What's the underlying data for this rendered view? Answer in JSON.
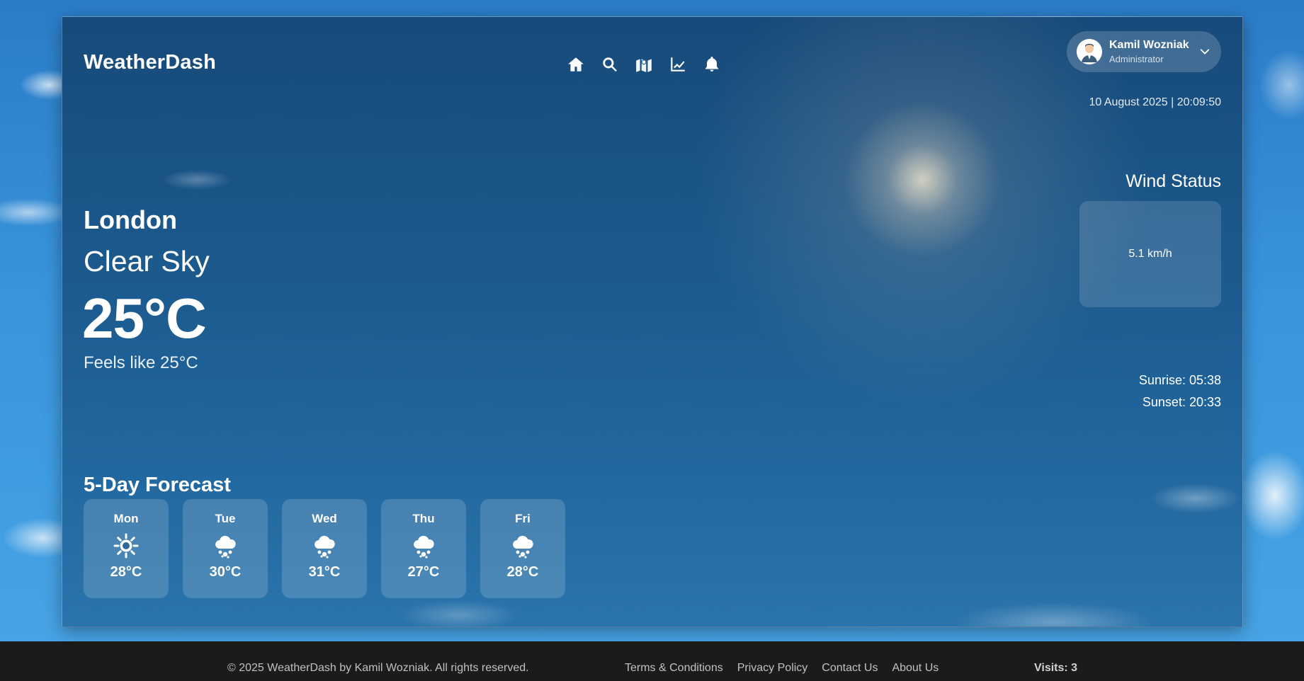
{
  "app": {
    "brand": "WeatherDash"
  },
  "nav": [
    {
      "icon": "home-icon"
    },
    {
      "icon": "search-icon"
    },
    {
      "icon": "map-icon"
    },
    {
      "icon": "chart-icon"
    },
    {
      "icon": "bell-icon"
    }
  ],
  "user": {
    "name": "Kamil Wozniak",
    "role": "Administrator",
    "avatar_icon": "user-avatar-icon",
    "dropdown_icon": "chevron-down-icon"
  },
  "datetime": "10 August 2025 | 20:09:50",
  "current": {
    "city": "London",
    "condition": "Clear Sky",
    "temperature": "25°C",
    "feels_like": "Feels like 25°C"
  },
  "wind": {
    "title": "Wind Status",
    "speed": "5.1 km/h"
  },
  "sun": {
    "sunrise": "Sunrise: 05:38",
    "sunset": "Sunset: 20:33"
  },
  "forecast": {
    "title": "5-Day Forecast",
    "days": [
      {
        "day": "Mon",
        "temp": "28°C",
        "icon": "sun-icon"
      },
      {
        "day": "Tue",
        "temp": "30°C",
        "icon": "snow-cloud-icon"
      },
      {
        "day": "Wed",
        "temp": "31°C",
        "icon": "snow-cloud-icon"
      },
      {
        "day": "Thu",
        "temp": "27°C",
        "icon": "snow-cloud-icon"
      },
      {
        "day": "Fri",
        "temp": "28°C",
        "icon": "snow-cloud-icon"
      }
    ]
  },
  "footer": {
    "copyright": "© 2025 WeatherDash by Kamil Wozniak. All rights reserved.",
    "links": [
      "Terms & Conditions",
      "Privacy Policy",
      "Contact Us",
      "About Us"
    ],
    "visits": "Visits: 3"
  },
  "colors": {
    "panel": "#1c5b8f",
    "sky": "#3a95dc",
    "footer": "#1b1b1b"
  }
}
